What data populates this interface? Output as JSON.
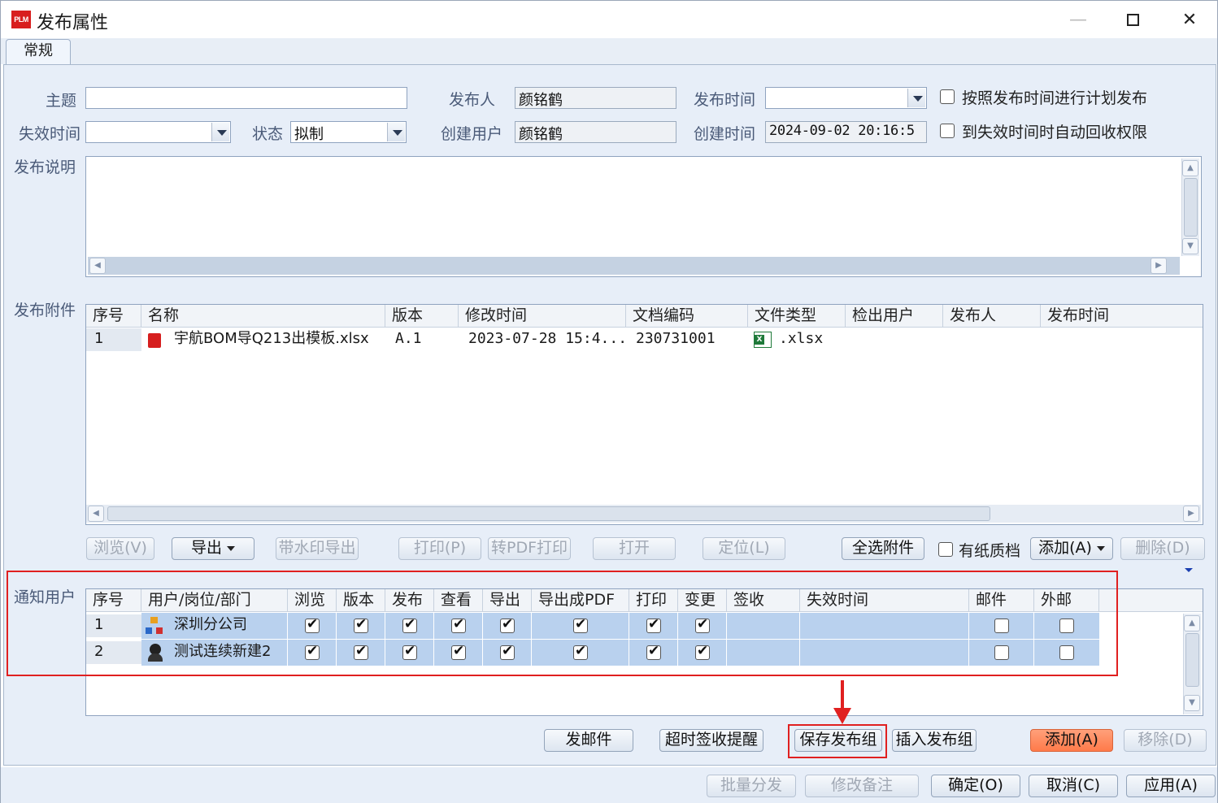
{
  "window": {
    "title": "发布属性",
    "logo_text": "PLM"
  },
  "tabs": [
    {
      "label": "常规"
    }
  ],
  "form": {
    "subject_label": "主题",
    "subject_value": "",
    "publisher_label": "发布人",
    "publisher_value": "颜铭鹤",
    "publish_time_label": "发布时间",
    "publish_time_value": "",
    "schedule_label": "按照发布时间进行计划发布",
    "expire_label": "失效时间",
    "expire_value": "",
    "status_label": "状态",
    "status_value": "拟制",
    "creator_label": "创建用户",
    "creator_value": "颜铭鹤",
    "create_time_label": "创建时间",
    "create_time_value": "2024-09-02 20:16:5",
    "auto_revoke_label": "到失效时间时自动回收权限",
    "desc_label": "发布说明",
    "desc_value": ""
  },
  "attachments": {
    "section_label": "发布附件",
    "columns": [
      "序号",
      "名称",
      "版本",
      "修改时间",
      "文档编码",
      "文件类型",
      "检出用户",
      "发布人",
      "发布时间"
    ],
    "rows": [
      {
        "no": "1",
        "name": "宇航BOM导Q213出模板.xlsx",
        "version": "A.1",
        "modified": "2023-07-28 15:4...",
        "code": "230731001",
        "type": ".xlsx",
        "checkout": "",
        "publisher": "",
        "pubtime": "",
        "icon": "pdf-red-icon",
        "type_icon": "excel-icon"
      }
    ],
    "buttons": {
      "browse": "浏览(V)",
      "export": "导出",
      "watermark_export": "带水印导出",
      "print": "打印(P)",
      "pdf_print": "转PDF打印",
      "open": "打开",
      "locate": "定位(L)",
      "select_all": "全选附件",
      "paper": "有纸质档",
      "add": "添加(A)",
      "delete": "删除(D)"
    }
  },
  "notify": {
    "section_label": "通知用户",
    "columns": [
      "序号",
      "用户/岗位/部门",
      "浏览",
      "版本",
      "发布",
      "查看",
      "导出",
      "导出成PDF",
      "打印",
      "变更",
      "签收",
      "失效时间",
      "邮件",
      "外邮"
    ],
    "rows": [
      {
        "no": "1",
        "name": "深圳分公司",
        "icon": "org-icon",
        "perms": [
          true,
          true,
          true,
          true,
          true,
          true,
          true,
          true
        ],
        "mail": false,
        "ext_mail": false
      },
      {
        "no": "2",
        "name": "测试连续新建2",
        "icon": "user-icon",
        "perms": [
          true,
          true,
          true,
          true,
          true,
          true,
          true,
          true
        ],
        "mail": false,
        "ext_mail": false
      }
    ],
    "buttons": {
      "send_mail": "发邮件",
      "timeout_remind": "超时签收提醒",
      "save_group": "保存发布组",
      "insert_group": "插入发布组",
      "add": "添加(A)",
      "remove": "移除(D)"
    }
  },
  "footer": {
    "batch": "批量分发",
    "edit_note": "修改备注",
    "ok": "确定(O)",
    "cancel": "取消(C)",
    "apply": "应用(A)"
  },
  "colors": {
    "accent": "#ff7a4a",
    "highlight": "#e02020",
    "selection": "#b9d1ee"
  }
}
